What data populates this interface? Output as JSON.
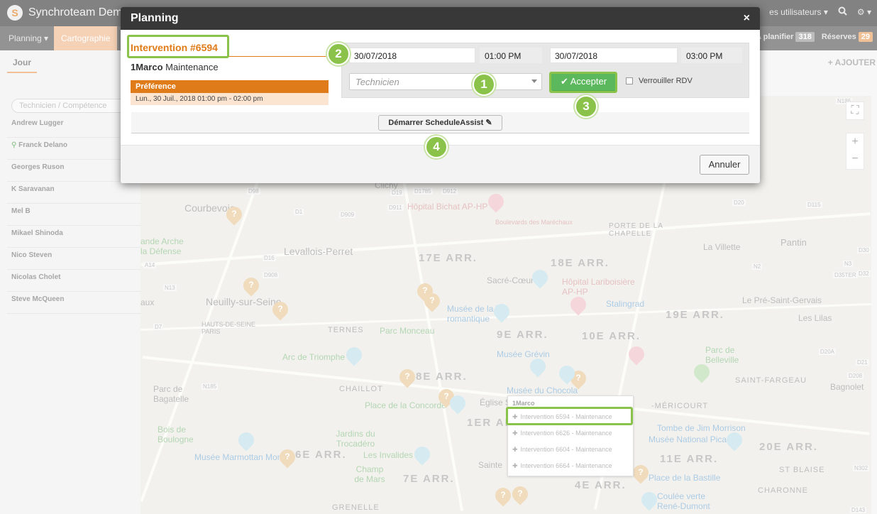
{
  "app": {
    "title": "Synchroteam Dem"
  },
  "navbar": {
    "users_label": "es utilisateurs",
    "search_icon": "search-icon",
    "settings_icon": "gear-icon"
  },
  "subnav": {
    "tabs": [
      {
        "label": "Planning"
      },
      {
        "label": "Cartographie"
      }
    ],
    "a_planifier_label": "A planifier",
    "a_planifier_count": "318",
    "reserves_label": "Réserves",
    "reserves_count": "29"
  },
  "left": {
    "day_tab": "Jour",
    "ajouter": "AJOUTER",
    "search_placeholder": "Technicien / Compétence",
    "technicians": [
      "Andrew Lugger",
      "Franck Delano",
      "Georges Ruson",
      "K Saravanan",
      "Mel B",
      "Mikael Shinoda",
      "Nico Steven",
      "Nicolas Cholet",
      "Steve McQueen"
    ]
  },
  "map": {
    "labels": {
      "courbevoie": "Courbevoie",
      "levallois": "Levallois-Perret",
      "neuilly": "Neuilly-sur-Seine",
      "arr17": "17E ARR.",
      "arr18": "18E ARR.",
      "arr9": "9E ARR.",
      "arr10": "10E ARR.",
      "arr19": "19E ARR.",
      "arr8": "8E ARR.",
      "arr1": "1ER ARR",
      "arr7": "7E ARR.",
      "arr4": "4E ARR.",
      "arr11": "11E ARR.",
      "arr20": "20E ARR.",
      "arr16": "6E ARR.",
      "pantin": "Pantin",
      "lavillette": "La Villette",
      "lepre": "Le Pré-Saint-Gervais",
      "leslilas": "Les Lilas",
      "bagnolet": "Bagnolet",
      "ternes": "TERNES",
      "chaillot": "CHAILLOT",
      "grenelle": "GRENELLE",
      "charonne": "CHARONNE",
      "stblaise": "ST BLAISE",
      "stfargeau": "SAINT-FARGEAU",
      "mericourt": "-MÉRICOURT",
      "portechapelle": "PORTE DE LA CHAPELLE",
      "clichy": "Clichy",
      "parcmonceau": "Parc Monceau",
      "arcdetriomphe": "Arc de Triomphe",
      "parcbagatelle": "Parc de Bagatelle",
      "boisboulogne": "Bois de Boulogne",
      "jardins": "Jardins du Trocadéro",
      "invalides": "Les Invalides",
      "champ": "Champ de Mars",
      "placeconcorde": "Place de la Concorde",
      "museevie": "Musée de la Vie romantique",
      "museegrevin": "Musée Grévin",
      "museechocolat": "Musée du Chocola",
      "marmottan": "Musée Marmottan Monet",
      "placebastille": "Place de la Bastille",
      "coulee": "Coulée verte René-Dumont",
      "tombe": "Tombe de Jim Morrison",
      "museepicasso": "Musée National Picasso",
      "hopitalbichat": "Hôpital Bichat AP-HP",
      "hopitallariboisiere": "Hôpital Lariboisière AP-HP",
      "stalingrad": "Stalingrad",
      "sacrecoeur": "Sacré-Cœur",
      "boulevards": "Boulevards des Maréchaux",
      "parcbelleville": "Parc de Belleville",
      "eglise": "Église S",
      "grandearche": "ande Arche la Défense",
      "hautsdeseine": "HAUTS-DE-SEINE PARIS",
      "saint": "Sainte",
      "aux": "aux",
      "d7": "D7",
      "d98": "D98",
      "d1": "D1",
      "d909": "D909",
      "d908": "D908",
      "d16": "D16",
      "a14": "A14",
      "n13": "N13",
      "n185": "N185",
      "d19": "D19",
      "d911": "D911",
      "d912": "D912",
      "d1785": "D1785",
      "n186": "N186",
      "d20": "D20",
      "d115": "D115",
      "n2": "N2",
      "n3": "N3",
      "d20a": "D20A",
      "d35ter": "D35TER",
      "d208": "D208",
      "d21": "D21",
      "n302": "N302",
      "d143": "D143",
      "d30": "D30",
      "d32": "D32"
    },
    "popup": {
      "title": "1Marco",
      "rows": [
        "Intervention 6594 - Maintenance",
        "Intervention 6626 - Maintenance",
        "Intervention 6604 - Maintenance",
        "Intervention 6664 - Maintenance"
      ]
    }
  },
  "modal": {
    "title": "Planning",
    "close": "×",
    "intervention_title": "Intervention #6594",
    "client_name": "1Marco",
    "client_type": "Maintenance",
    "preference_label": "Préférence",
    "preference_value": "Lun., 30 Juil., 2018 01:00 pm - 02:00 pm",
    "start_date": "30/07/2018",
    "start_time": "01:00 PM",
    "end_date": "30/07/2018",
    "end_time": "03:00 PM",
    "technician_placeholder": "Technicien",
    "accept_label": "Accepter",
    "lock_label": "Verrouiller RDV",
    "scheduleassist_label": "Démarrer ScheduleAssist",
    "cancel_label": "Annuler"
  },
  "callouts": [
    "1",
    "2",
    "3",
    "4"
  ],
  "colors": {
    "accent": "#e07b1a",
    "callout": "#8bc34a",
    "accept": "#5cb85c"
  }
}
